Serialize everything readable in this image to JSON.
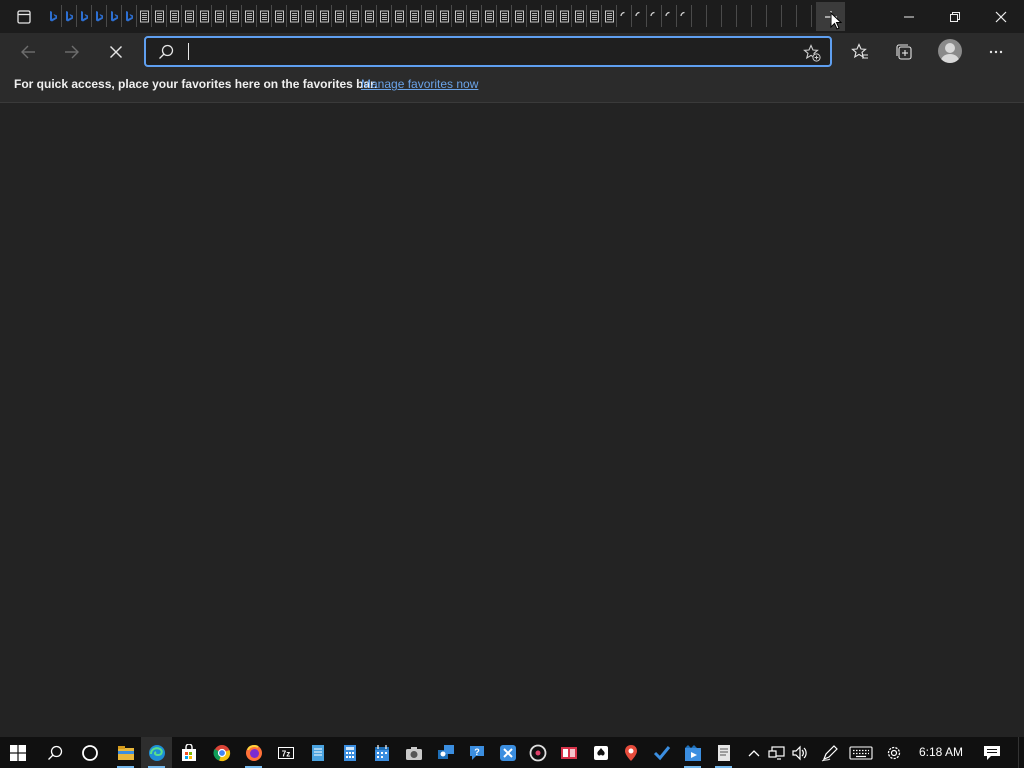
{
  "browser": {
    "tab_icons": [
      "bing-icon",
      "bing-icon",
      "bing-icon",
      "bing-icon",
      "bing-icon",
      "bing-icon",
      "page-icon",
      "page-icon",
      "page-icon",
      "page-icon",
      "page-icon",
      "page-icon",
      "page-icon",
      "page-icon",
      "page-icon",
      "page-icon",
      "page-icon",
      "page-icon",
      "page-icon",
      "page-icon",
      "page-icon",
      "page-icon",
      "page-icon",
      "page-icon",
      "page-icon",
      "page-icon",
      "page-icon",
      "page-icon",
      "page-icon",
      "page-icon",
      "page-icon",
      "page-icon",
      "page-icon",
      "page-icon",
      "page-icon",
      "page-icon",
      "page-icon",
      "page-icon",
      "loading-icon",
      "loading-icon",
      "loading-icon",
      "loading-icon",
      "loading-icon",
      "tab-divider",
      "tab-divider",
      "tab-divider",
      "tab-divider",
      "tab-divider",
      "tab-divider",
      "tab-divider",
      "tab-divider",
      "tab-divider",
      "tab-divider"
    ],
    "window_controls": [
      "minimize-icon",
      "restore-icon",
      "close-icon"
    ]
  },
  "toolbar": {
    "back_icon": "back-arrow-icon",
    "forward_icon": "forward-arrow-icon",
    "stop_icon": "stop-loading-icon",
    "address_value": "",
    "address_placeholder": "",
    "right_icons": [
      "favorites-icon",
      "collections-icon",
      "profile-avatar",
      "more-menu-icon"
    ]
  },
  "favorites_bar": {
    "message": "For quick access, place your favorites here on the favorites bar.",
    "link": "Manage favorites now"
  },
  "taskbar": {
    "apps": [
      "start-icon",
      "search-icon",
      "cortana-icon",
      "file-explorer-icon",
      "edge-icon",
      "store-icon",
      "chrome-icon",
      "firefox-icon",
      "7zip-icon",
      "notepad-icon",
      "calculator-icon",
      "calendar-icon",
      "camera-icon",
      "feedback-icon",
      "get-help-icon",
      "xbox-icon",
      "groove-icon",
      "news-icon",
      "solitaire-icon",
      "maps-icon",
      "todo-icon",
      "movies-icon",
      "document-icon"
    ],
    "tray_icons": [
      "chevron-up-icon",
      "network-icon",
      "volume-icon",
      "pen-icon",
      "keyboard-icon",
      "settings-icon"
    ],
    "clock": "6:18 AM",
    "notification_icon": "action-center-icon"
  },
  "colors": {
    "accent": "#5f9ff0",
    "link": "#6aa3e8",
    "background": "#232323",
    "titlebar": "#1c1c1c",
    "toolbar": "#2b2b2b",
    "taskbar": "#101010"
  }
}
